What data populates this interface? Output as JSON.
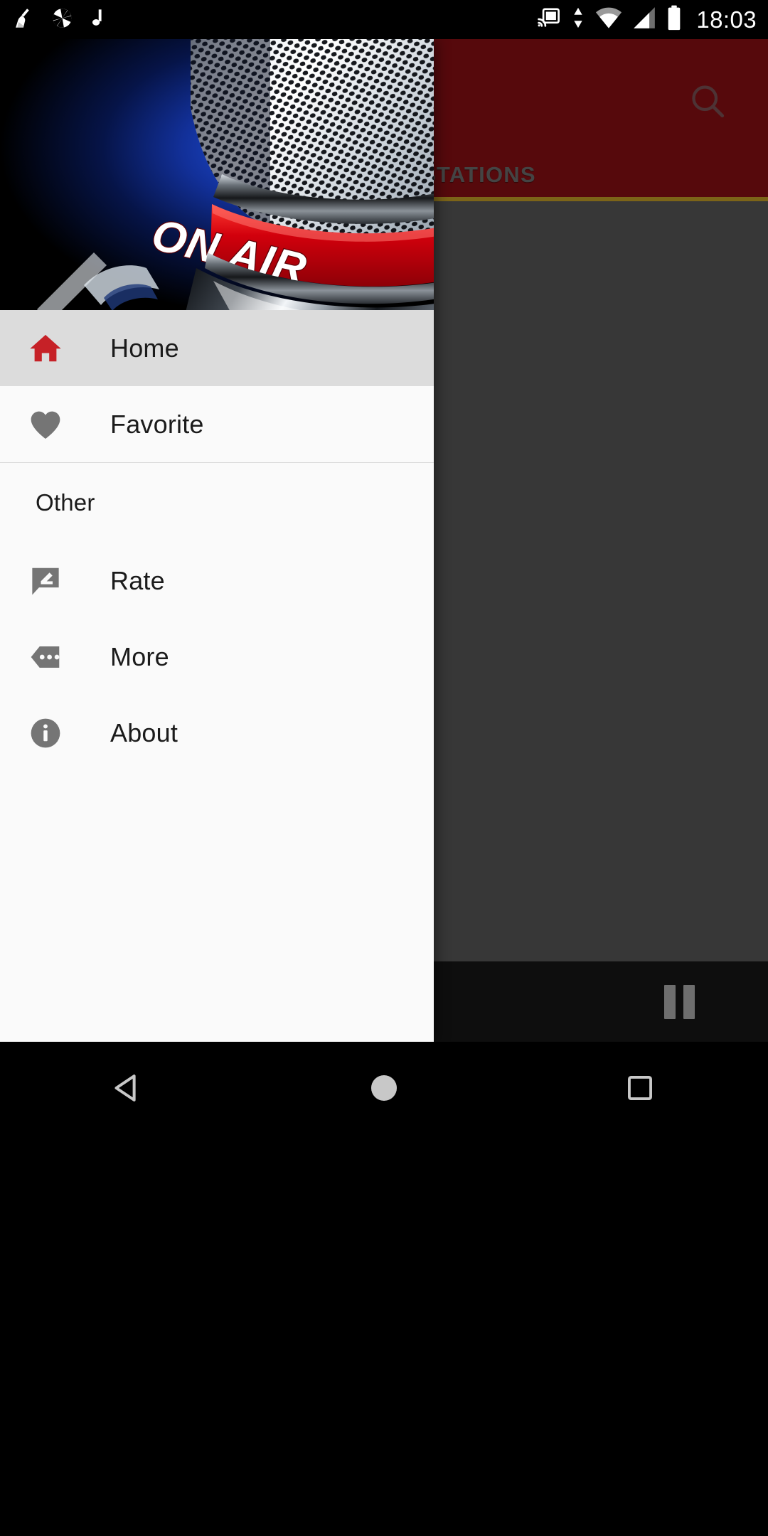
{
  "status_bar": {
    "time": "18:03",
    "left_icons": [
      {
        "name": "broom-clean-icon",
        "label": "Cleaner"
      },
      {
        "name": "camera-aperture-icon",
        "label": "Camera"
      },
      {
        "name": "music-note-icon",
        "label": "Music"
      }
    ],
    "right_icons": [
      {
        "name": "cast-icon",
        "label": "Cast"
      },
      {
        "name": "data-transfer-icon",
        "label": "Data transfer"
      },
      {
        "name": "wifi-icon",
        "label": "Wi-Fi"
      },
      {
        "name": "cellular-signal-icon",
        "label": "Signal"
      },
      {
        "name": "battery-icon",
        "label": "Battery"
      }
    ]
  },
  "app_behind": {
    "accent_color": "#8c1014",
    "search_icon": "search-icon",
    "tabs": [
      {
        "label": "STATIONS",
        "selected": false
      }
    ],
    "player": {
      "state_icon": "pause-icon",
      "state_label": "Pause"
    }
  },
  "drawer": {
    "header": {
      "artwork_name": "on-air-microphone-banner",
      "banner_text": "ON AIR"
    },
    "primary_items": [
      {
        "id": "home",
        "label": "Home",
        "icon": "home-icon",
        "icon_color": "#c62127",
        "selected": true
      },
      {
        "id": "favorite",
        "label": "Favorite",
        "icon": "heart-icon",
        "icon_color": "#757575",
        "selected": false
      }
    ],
    "section_title": "Other",
    "other_items": [
      {
        "id": "rate",
        "label": "Rate",
        "icon": "rate-review-icon",
        "icon_color": "#757575",
        "selected": false
      },
      {
        "id": "more",
        "label": "More",
        "icon": "more-tag-icon",
        "icon_color": "#757575",
        "selected": false
      },
      {
        "id": "about",
        "label": "About",
        "icon": "info-icon",
        "icon_color": "#757575",
        "selected": false
      }
    ]
  },
  "navigation_bar": {
    "buttons": [
      {
        "id": "back",
        "label": "Back",
        "icon": "back-triangle-icon"
      },
      {
        "id": "home",
        "label": "Home",
        "icon": "home-circle-icon"
      },
      {
        "id": "recent",
        "label": "Recents",
        "icon": "recents-square-icon"
      }
    ]
  }
}
